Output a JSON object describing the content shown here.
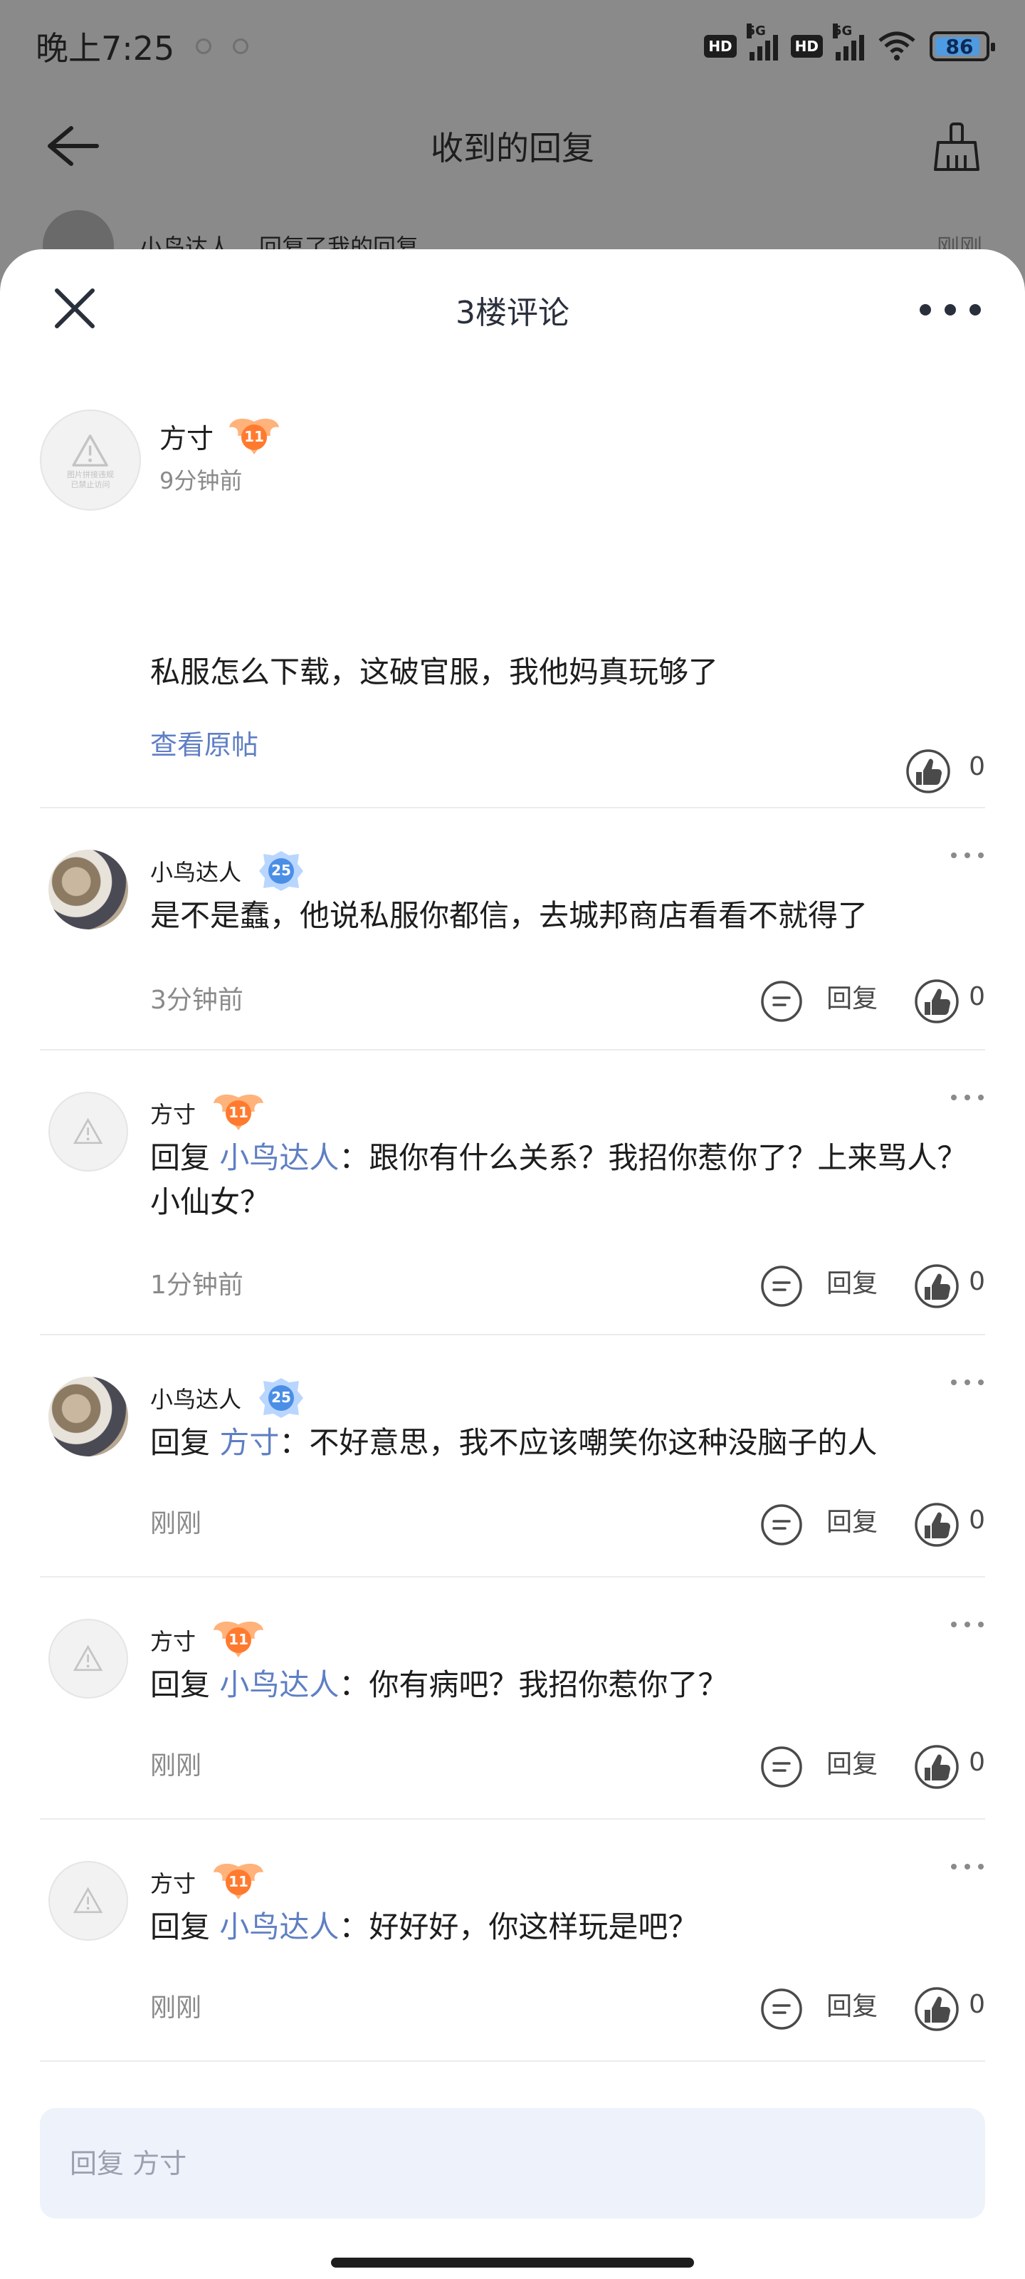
{
  "status": {
    "time": "晚上7:25",
    "hd1": "HD",
    "hd2": "HD",
    "net1": "5G",
    "net2": "5G",
    "battery": "86"
  },
  "nav": {
    "title": "收到的回复"
  },
  "background_item": {
    "name": "小鸟达人",
    "action": "回复了我的回复",
    "time": "刚刚"
  },
  "sheet": {
    "title": "3楼评论"
  },
  "main_comment": {
    "author": "方寸",
    "level": "11",
    "time": "9分钟前",
    "text": "私服怎么下载，这破官服，我他妈真玩够了",
    "view_link": "查看原帖",
    "likes": "0",
    "avatar_text_1": "图片拼接违规",
    "avatar_text_2": "已禁止访问"
  },
  "reply_label": "回复",
  "replies": [
    {
      "author": "小鸟达人",
      "level": "25",
      "lead": "",
      "mention": "",
      "text": "是不是蠢，他说私服你都信，去城邦商店看看不就得了",
      "time": "3分钟前",
      "likes": "0"
    },
    {
      "author": "方寸",
      "level": "11",
      "lead": "回复 ",
      "mention": "小鸟达人",
      "text": "：跟你有什么关系？我招你惹你了？上来骂人？小仙女？",
      "time": "1分钟前",
      "likes": "0"
    },
    {
      "author": "小鸟达人",
      "level": "25",
      "lead": "回复 ",
      "mention": "方寸",
      "text": "：不好意思，我不应该嘲笑你这种没脑子的人",
      "time": "刚刚",
      "likes": "0"
    },
    {
      "author": "方寸",
      "level": "11",
      "lead": "回复 ",
      "mention": "小鸟达人",
      "text": "：你有病吧？我招你惹你了？",
      "time": "刚刚",
      "likes": "0"
    },
    {
      "author": "方寸",
      "level": "11",
      "lead": "回复 ",
      "mention": "小鸟达人",
      "text": "：好好好，你这样玩是吧？",
      "time": "刚刚",
      "likes": "0"
    }
  ],
  "reply_input": {
    "placeholder": "回复 方寸"
  },
  "colors": {
    "accent_link": "#5f7fc4",
    "level_orange": "#ff7a2f",
    "level_blue": "#4a8ee6",
    "input_bg": "#eef2fb"
  }
}
